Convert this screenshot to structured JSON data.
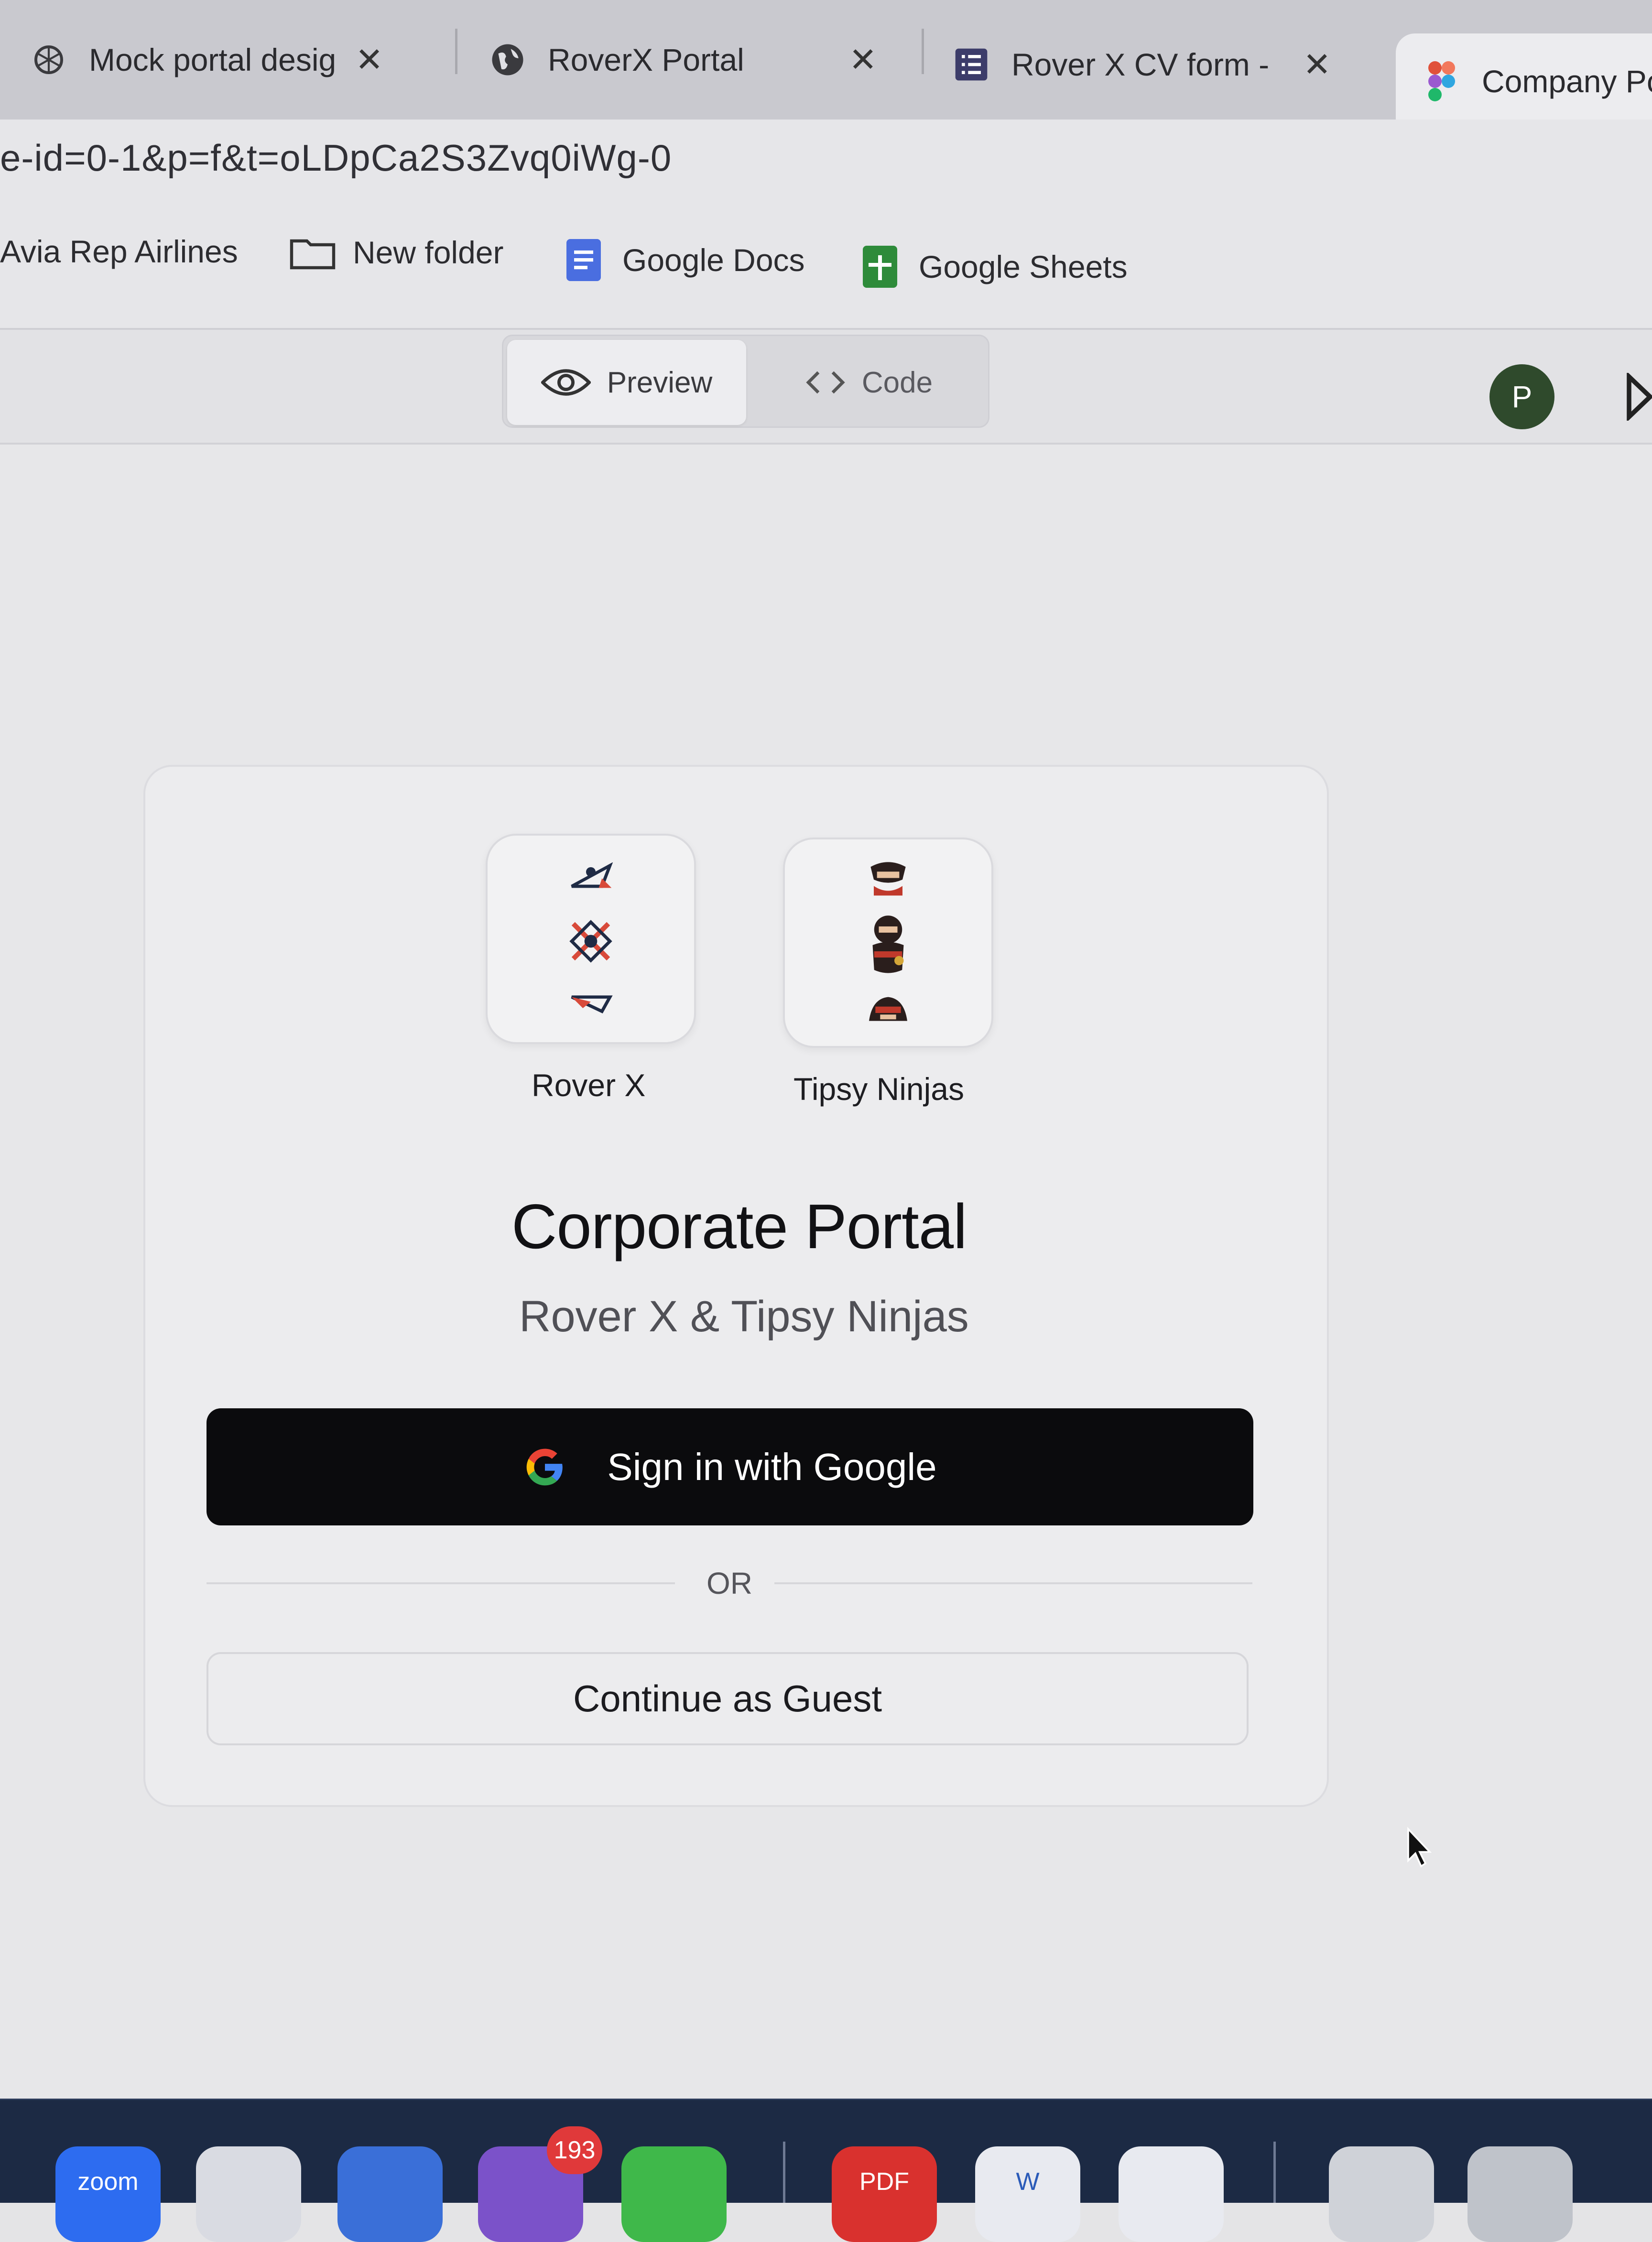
{
  "browser": {
    "tabs": [
      {
        "title": "Mock portal desig",
        "icon": "openai-icon",
        "closable": true
      },
      {
        "title": "RoverX Portal",
        "icon": "globe-icon",
        "closable": true
      },
      {
        "title": "Rover X CV form -",
        "icon": "forms-list-icon",
        "closable": true
      },
      {
        "title": "Company Pc",
        "icon": "figma-icon",
        "closable": false
      }
    ],
    "close_glyph": "✕",
    "url": "e-id=0-1&p=f&t=oLDpCa2S3Zvq0iWg-0",
    "bookmarks": [
      {
        "label": "Avia Rep Airlines"
      },
      {
        "label": "New folder",
        "icon": "folder-icon"
      },
      {
        "label": "Google Docs",
        "icon": "google-docs-icon"
      },
      {
        "label": "Google Sheets",
        "icon": "google-sheets-icon"
      }
    ]
  },
  "toolbar": {
    "preview_label": "Preview",
    "code_label": "Code",
    "active_view": "Preview",
    "avatar_initial": "P"
  },
  "portal": {
    "brands": [
      {
        "name": "Rover X",
        "logo": "rover-x-logo"
      },
      {
        "name": "Tipsy Ninjas",
        "logo": "tipsy-ninjas-logo"
      }
    ],
    "title": "Corporate Portal",
    "subtitle": "Rover X & Tipsy Ninjas",
    "google_button_label": "Sign in with Google",
    "divider_text": "OR",
    "guest_button_label": "Continue as Guest"
  },
  "dock": {
    "apps": [
      {
        "name": "zoom",
        "label": "zoom"
      },
      {
        "name": "phone-app"
      },
      {
        "name": "app-blue"
      },
      {
        "name": "viber",
        "badge": "193"
      },
      {
        "name": "whatsapp"
      },
      {
        "name": "pdf-app",
        "label": "PDF"
      },
      {
        "name": "word",
        "label": "W"
      },
      {
        "name": "onedrive"
      },
      {
        "name": "documents"
      },
      {
        "name": "trash"
      }
    ]
  },
  "colors": {
    "primary_button": "#0b0b0d",
    "avatar_bg": "#2f4a2c",
    "badge": "#e0393a",
    "ninja_red": "#c0392b"
  }
}
